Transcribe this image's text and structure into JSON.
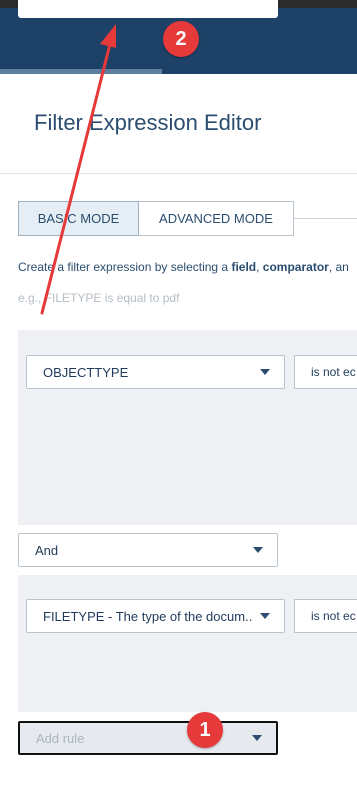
{
  "header": {
    "search_value": ""
  },
  "page": {
    "title": "Filter Expression Editor"
  },
  "tabs": [
    {
      "label": "BASIC MODE",
      "active": true
    },
    {
      "label": "ADVANCED MODE",
      "active": false
    }
  ],
  "instructions": {
    "part1": "Create a filter expression by selecting a ",
    "field": "field",
    "sep": ", ",
    "comparator": "comparator",
    "part2": ", an",
    "example": "e.g., FILETYPE is equal to pdf"
  },
  "rule1": {
    "field": "OBJECTTYPE",
    "comparator": "is not ec"
  },
  "connector": {
    "value": "And"
  },
  "rule2": {
    "field": "FILETYPE - The type of the docum...",
    "comparator": "is not ec"
  },
  "add_rule": {
    "placeholder": "Add rule"
  },
  "annotations": {
    "badge1": "1",
    "badge2": "2",
    "color": "#e5393a"
  }
}
